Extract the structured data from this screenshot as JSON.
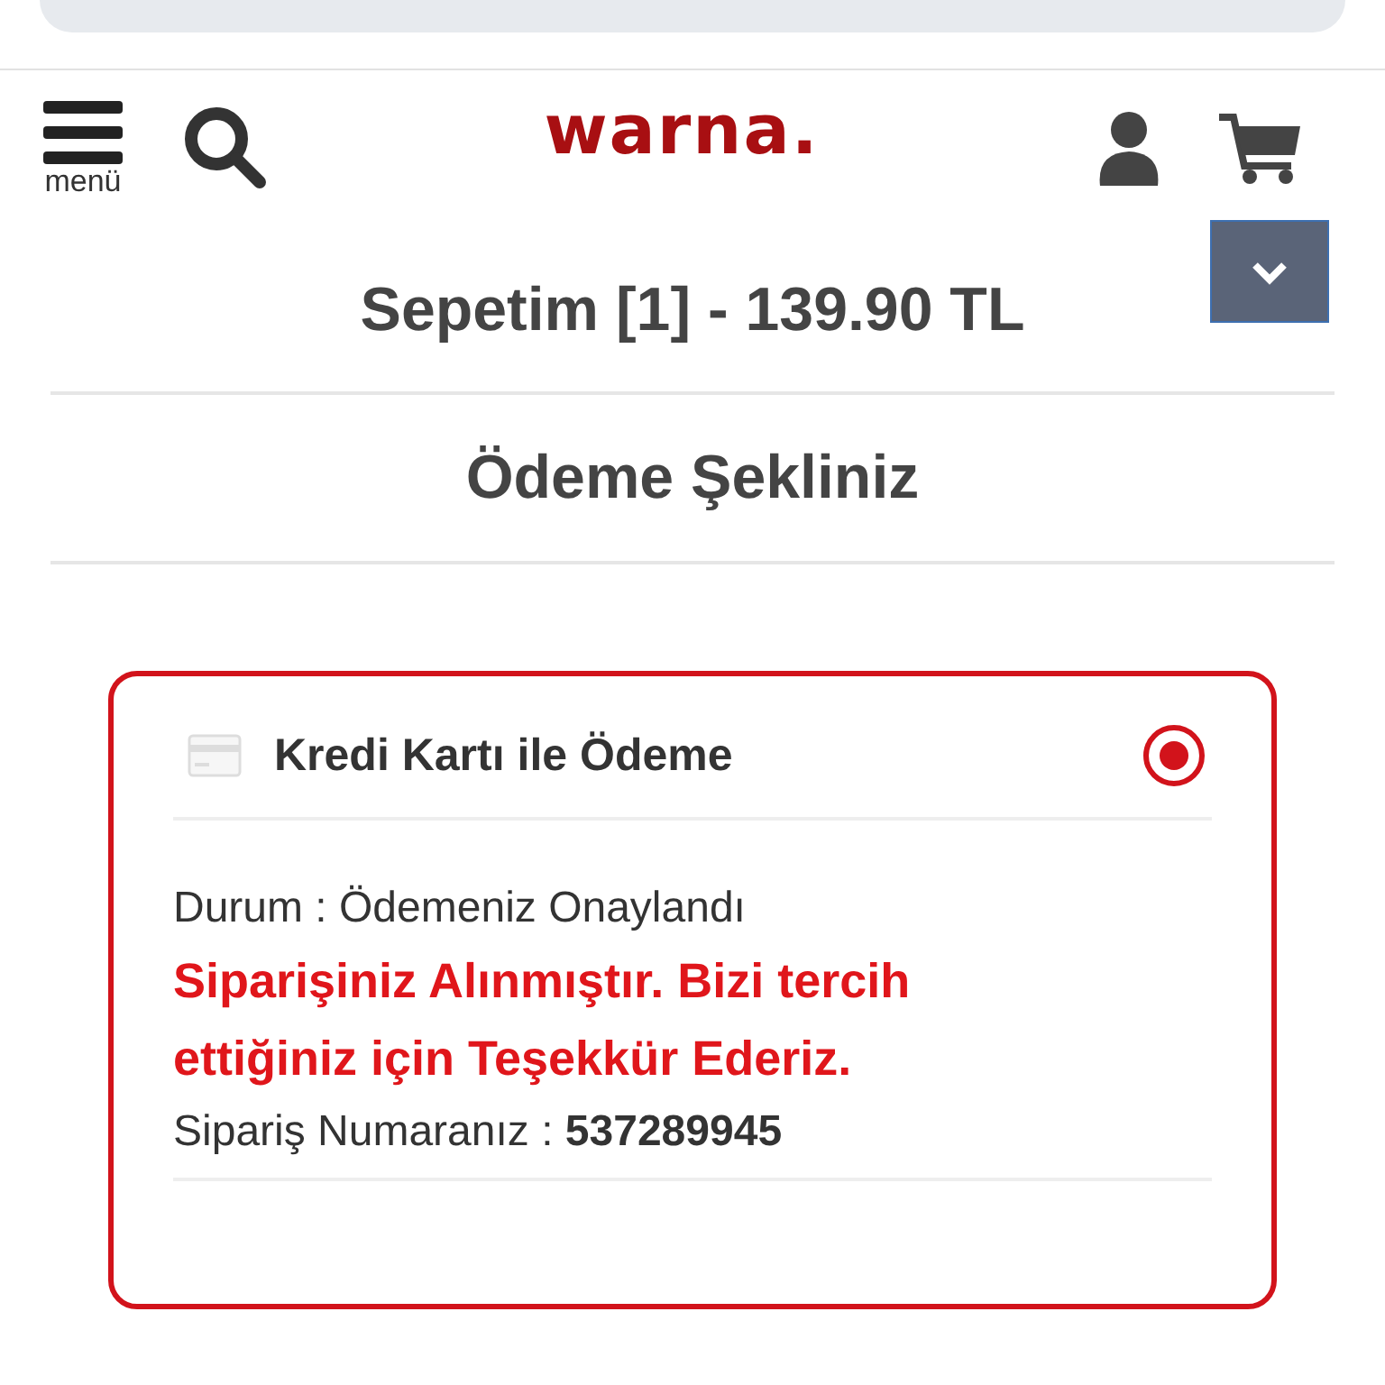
{
  "header": {
    "menu_label": "menü",
    "logo": "warna."
  },
  "cart": {
    "title": "Sepetim [1] - 139.90 TL",
    "expanded": false
  },
  "section_title": "Ödeme Şekliniz",
  "payment_option": {
    "label": "Kredi Kartı ile Ödeme",
    "selected": true
  },
  "status": "Durum : Ödemeniz Onaylandı",
  "message": "Siparişiniz Alınmıştır. Bizi tercih ettiğiniz için Teşekkür Ederiz.",
  "order_number": "Sipariş Numaranız : **537289945**"
}
